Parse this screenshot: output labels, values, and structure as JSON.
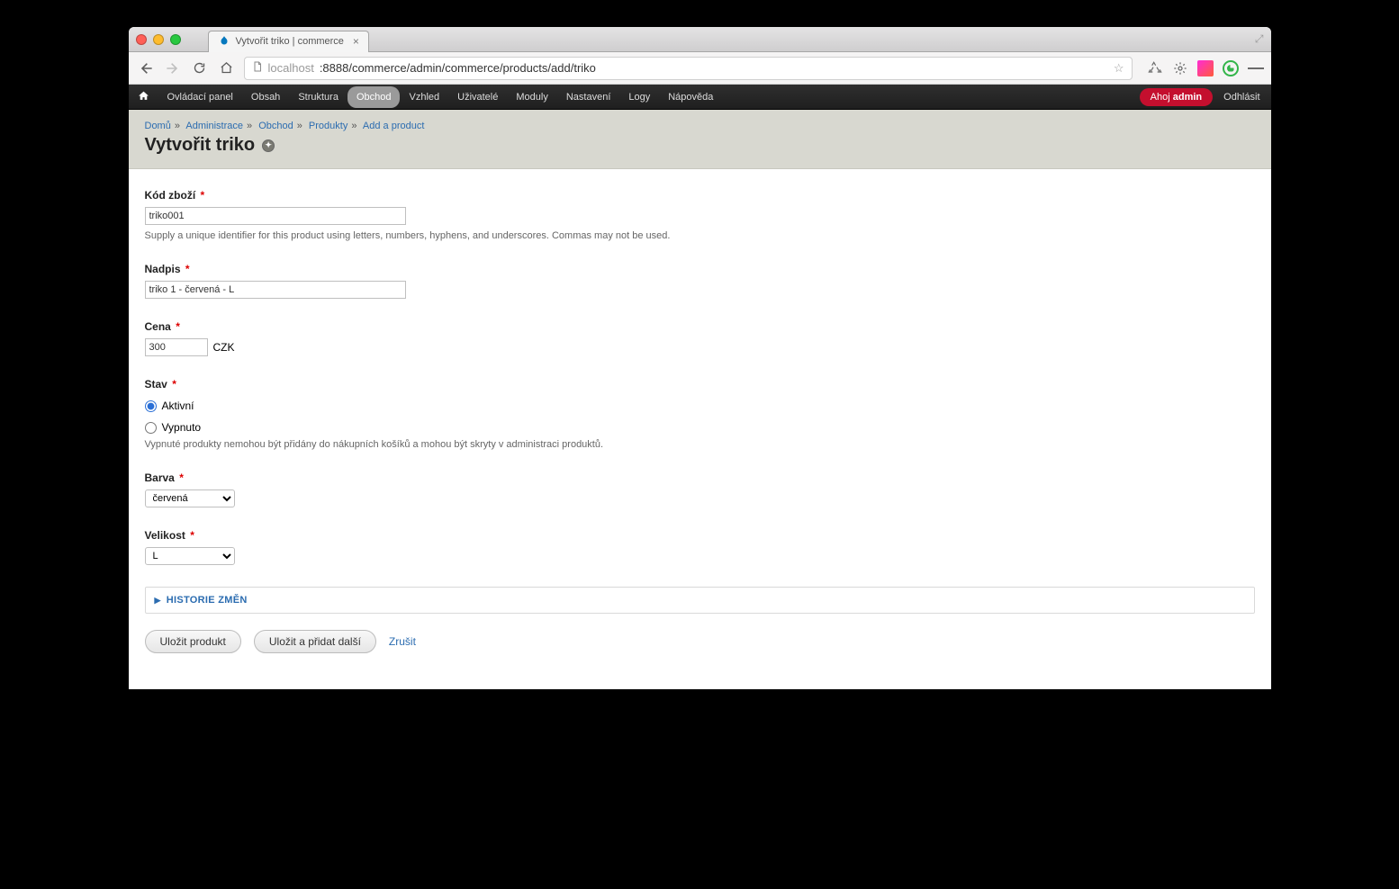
{
  "browser": {
    "tab_title": "Vytvořit triko | commerce",
    "url_host": "localhost",
    "url_port_path": ":8888/commerce/admin/commerce/products/add/triko"
  },
  "admin_toolbar": {
    "items": [
      "Ovládací panel",
      "Obsah",
      "Struktura",
      "Obchod",
      "Vzhled",
      "Uživatelé",
      "Moduly",
      "Nastavení",
      "Logy",
      "Nápověda"
    ],
    "active_index": 3,
    "hello_prefix": "Ahoj ",
    "hello_user": "admin",
    "logout": "Odhlásit"
  },
  "breadcrumbs": [
    "Domů",
    "Administrace",
    "Obchod",
    "Produkty",
    "Add a product"
  ],
  "page_title": "Vytvořit triko",
  "form": {
    "sku": {
      "label": "Kód zboží",
      "value": "triko001",
      "help": "Supply a unique identifier for this product using letters, numbers, hyphens, and underscores. Commas may not be used."
    },
    "title": {
      "label": "Nadpis",
      "value": "triko 1 - červená - L"
    },
    "price": {
      "label": "Cena",
      "value": "300",
      "currency": "CZK"
    },
    "status": {
      "label": "Stav",
      "options": [
        {
          "label": "Aktivní",
          "checked": true
        },
        {
          "label": "Vypnuto",
          "checked": false
        }
      ],
      "help": "Vypnuté produkty nemohou být přidány do nákupních košíků a mohou být skryty v administraci produktů."
    },
    "color": {
      "label": "Barva",
      "selected": "červená"
    },
    "size": {
      "label": "Velikost",
      "selected": "L"
    },
    "history_legend": "HISTORIE ZMĚN",
    "actions": {
      "save": "Uložit produkt",
      "save_add": "Uložit a přidat další",
      "cancel": "Zrušit"
    }
  }
}
